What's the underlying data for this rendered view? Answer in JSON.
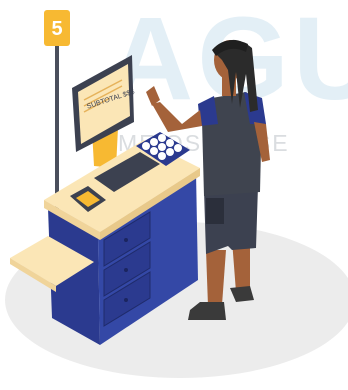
{
  "watermark": {
    "big_text": "AGU",
    "small_text": "MEIOS DE SE"
  },
  "kiosk": {
    "lane_number": "5",
    "screen_text": "SUBTOTAL $$$"
  },
  "colors": {
    "navy": "#2b3a8f",
    "cream": "#fbe6b6",
    "yellow": "#f7b932",
    "skin": "#a4623a",
    "dark": "#3a3a3a",
    "floor": "#ebebeb"
  }
}
